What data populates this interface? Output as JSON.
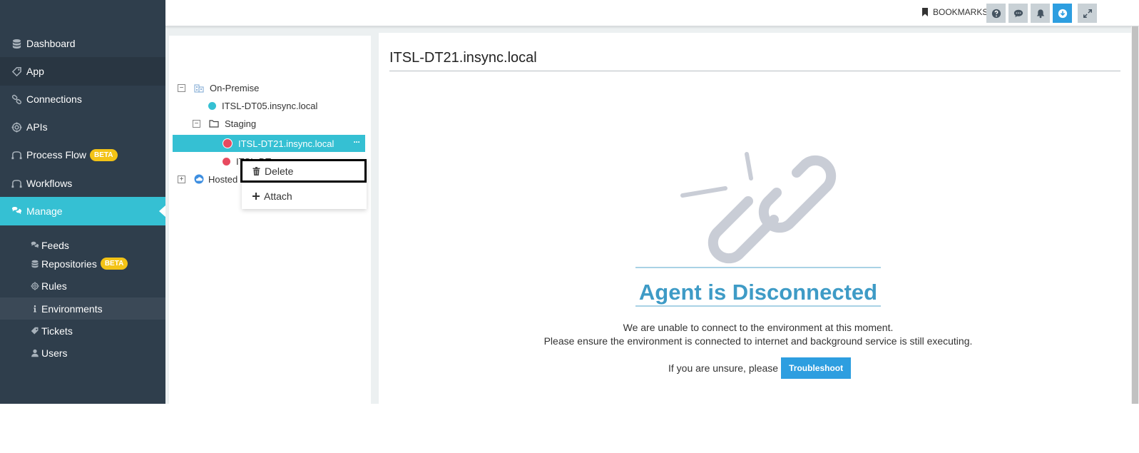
{
  "sidebar": {
    "items": [
      {
        "label": "Dashboard",
        "icon": "database-icon"
      },
      {
        "label": "App",
        "icon": "tag-icon"
      },
      {
        "label": "Connections",
        "icon": "link-icon"
      },
      {
        "label": "APIs",
        "icon": "cog-icon"
      },
      {
        "label": "Process Flow",
        "icon": "flow-icon",
        "badge": "BETA"
      },
      {
        "label": "Workflows",
        "icon": "flow-icon"
      },
      {
        "label": "Manage",
        "icon": "comments-icon"
      }
    ],
    "sub_items": [
      {
        "label": "Feeds",
        "icon": "comments-icon"
      },
      {
        "label": "Repositories",
        "icon": "database-icon",
        "badge": "BETA"
      },
      {
        "label": "Rules",
        "icon": "cog-icon"
      },
      {
        "label": "Environments",
        "icon": "info-icon"
      },
      {
        "label": "Tickets",
        "icon": "tag-icon"
      },
      {
        "label": "Users",
        "icon": "user-icon"
      }
    ]
  },
  "topbar": {
    "bookmarks_label": "BOOKMARKS",
    "buttons": [
      "help-icon",
      "chat-icon",
      "bell-icon",
      "download-icon",
      "expand-icon"
    ]
  },
  "tree": {
    "on_premise": "On-Premise",
    "dt05": "ITSL-DT05.insync.local",
    "staging": "Staging",
    "dt21": "ITSL-DT21.insync.local",
    "hidden_node": "ITSL-DT",
    "hosted": "Hosted",
    "more": "···"
  },
  "context_menu": {
    "delete_label": "Delete",
    "attach_label": "Attach"
  },
  "main": {
    "title": "ITSL-DT21.insync.local",
    "status_title": "Agent is Disconnected",
    "line1": "We are unable to connect to the environment at this moment.",
    "line2": "Please ensure the environment is connected to internet and background service is still executing.",
    "unsure": "If you are unsure, please",
    "troubleshoot_label": "Troubleshoot"
  },
  "colors": {
    "sidebar_bg": "#2f3e4c",
    "accent": "#35c0d3",
    "badge": "#f3c316",
    "title_blue": "#3e9bc6",
    "button_blue": "#2d9ee0",
    "status_red": "#e84a5f",
    "status_teal": "#35c0d3"
  }
}
